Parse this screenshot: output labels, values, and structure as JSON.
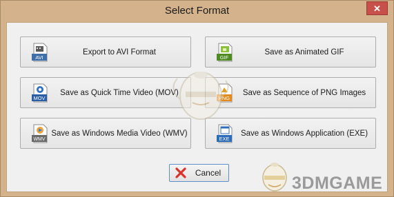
{
  "window": {
    "title": "Select Format",
    "close_glyph": "✕"
  },
  "buttons": [
    {
      "id": "avi",
      "label": "Export to AVI Format",
      "icon_text": "AVI",
      "icon": "avi-file-icon"
    },
    {
      "id": "gif",
      "label": "Save as Animated GIF",
      "icon_text": "GIF",
      "icon": "gif-file-icon"
    },
    {
      "id": "mov",
      "label": "Save as Quick Time Video (MOV)",
      "icon_text": "MOV",
      "icon": "mov-file-icon"
    },
    {
      "id": "png",
      "label": "Save as Sequence of PNG Images",
      "icon_text": "PNG",
      "icon": "png-file-icon"
    },
    {
      "id": "wmv",
      "label": "Save as Windows Media Video (WMV)",
      "icon_text": "WMV",
      "icon": "wmv-file-icon"
    },
    {
      "id": "exe",
      "label": "Save as Windows Application (EXE)",
      "icon_text": "EXE",
      "icon": "exe-file-icon"
    }
  ],
  "cancel": {
    "label": "Cancel",
    "icon": "red-x-icon"
  },
  "watermark": {
    "text": "3DMGAME"
  },
  "colors": {
    "frame": "#d4b28c",
    "client": "#f0f0f0",
    "close": "#c7504a",
    "cancel_x": "#d9332b"
  }
}
